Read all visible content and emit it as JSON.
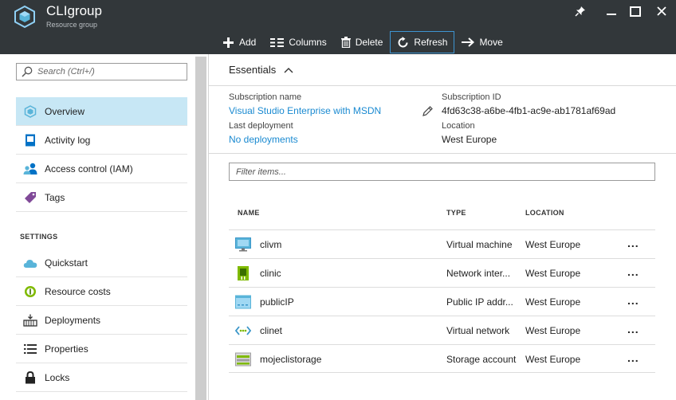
{
  "header": {
    "title": "CLIgroup",
    "subtitle": "Resource group",
    "toolbar": [
      {
        "label": "Add",
        "icon": "plus-icon"
      },
      {
        "label": "Columns",
        "icon": "columns-icon"
      },
      {
        "label": "Delete",
        "icon": "trash-icon"
      },
      {
        "label": "Refresh",
        "icon": "refresh-icon",
        "active": true
      },
      {
        "label": "Move",
        "icon": "arrow-right-icon"
      }
    ]
  },
  "sidebar": {
    "search_placeholder": "Search (Ctrl+/)",
    "items": [
      {
        "label": "Overview",
        "icon": "resource-group-icon",
        "selected": true
      },
      {
        "label": "Activity log",
        "icon": "activity-log-icon"
      },
      {
        "label": "Access control (IAM)",
        "icon": "users-icon"
      },
      {
        "label": "Tags",
        "icon": "tag-icon"
      }
    ],
    "settings_heading": "SETTINGS",
    "settings_items": [
      {
        "label": "Quickstart",
        "icon": "cloud-icon"
      },
      {
        "label": "Resource costs",
        "icon": "cost-icon"
      },
      {
        "label": "Deployments",
        "icon": "deployments-icon"
      },
      {
        "label": "Properties",
        "icon": "properties-icon"
      },
      {
        "label": "Locks",
        "icon": "lock-icon"
      }
    ]
  },
  "essentials": {
    "title": "Essentials",
    "subscription_name_label": "Subscription name",
    "subscription_name": "Visual Studio Enterprise with MSDN",
    "subscription_id_label": "Subscription ID",
    "subscription_id": "4fd63c38-a6be-4fb1-ac9e-ab1781af69ad",
    "last_deployment_label": "Last deployment",
    "last_deployment": "No deployments",
    "location_label": "Location",
    "location": "West Europe"
  },
  "resources": {
    "filter_placeholder": "Filter items...",
    "columns": {
      "name": "NAME",
      "type": "TYPE",
      "location": "LOCATION"
    },
    "rows": [
      {
        "name": "clivm",
        "type": "Virtual machine",
        "location": "West Europe",
        "icon": "virtual-machine-icon"
      },
      {
        "name": "clinic",
        "type": "Network inter...",
        "location": "West Europe",
        "icon": "network-interface-icon"
      },
      {
        "name": "publicIP",
        "type": "Public IP addr...",
        "location": "West Europe",
        "icon": "public-ip-icon"
      },
      {
        "name": "clinet",
        "type": "Virtual network",
        "location": "West Europe",
        "icon": "virtual-network-icon"
      },
      {
        "name": "mojeclistorage",
        "type": "Storage account",
        "location": "West Europe",
        "icon": "storage-account-icon"
      }
    ],
    "more_label": "..."
  },
  "colors": {
    "header_bg": "#32373a",
    "accent": "#1a8ad1",
    "selected_nav": "#c7e7f5"
  }
}
